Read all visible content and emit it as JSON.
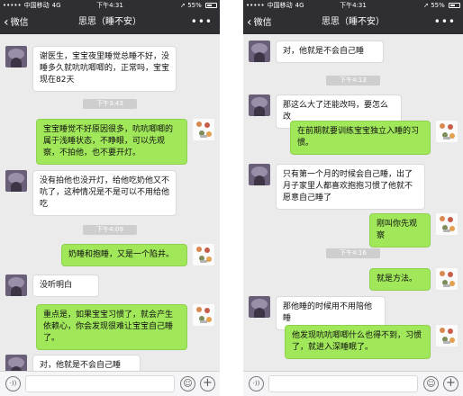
{
  "colors": {
    "navbar": "#2e2e33",
    "chat_bg": "#ebebeb",
    "bubble_out": "#a0e75a",
    "bubble_in": "#ffffff",
    "timestamp_bg": "#cecece",
    "input_bar": "#f5f5f7"
  },
  "status_bar": {
    "signal": "•••••",
    "carrier": "中国移动",
    "network": "4G",
    "time": "下午4:31",
    "location_icon": "location-arrow-icon",
    "battery_percent": "55%",
    "battery_level": 0.55
  },
  "nav": {
    "back_label": "微信",
    "title": "思思（睡不安）",
    "more_label": "•••"
  },
  "input_bar": {
    "voice_icon": "voice-icon",
    "voice_glyph": "·))",
    "emoji_icon": "emoji-icon",
    "emoji_glyph": "☺",
    "plus_icon": "plus-icon",
    "plus_glyph": "+"
  },
  "left_chat": [
    {
      "kind": "message",
      "sender": "doctor-client",
      "direction": "in",
      "text": "谢医生，宝宝夜里睡觉总睡不好，没睡多久就吭吭唧唧的，正常吗，宝宝现在82天"
    },
    {
      "kind": "timestamp",
      "text": "下午3:43"
    },
    {
      "kind": "message",
      "sender": "self",
      "direction": "out",
      "text": "宝宝睡觉不好原因很多，吭吭唧唧的属于浅睡状态，不睁眼，可以先观察，不拍他，也不要开灯。"
    },
    {
      "kind": "message",
      "sender": "doctor-client",
      "direction": "in",
      "text": "没有拍他也没开灯，给他吃奶他又不吭了，这种情况是不是可以不用给他吃"
    },
    {
      "kind": "timestamp",
      "text": "下午4:09"
    },
    {
      "kind": "message",
      "sender": "self",
      "direction": "out",
      "text": "奶睡和抱睡，又是一个陷井。"
    },
    {
      "kind": "message",
      "sender": "doctor-client",
      "direction": "in",
      "text": "没听明白"
    },
    {
      "kind": "message",
      "sender": "self",
      "direction": "out",
      "text": "重点是，如果宝宝习惯了，就会产生依赖心，你会发现很难让宝宝自己睡了。"
    },
    {
      "kind": "message",
      "sender": "doctor-client",
      "direction": "in",
      "text": "对，他就是不会自己睡"
    }
  ],
  "right_chat": [
    {
      "kind": "message",
      "sender": "doctor-client",
      "direction": "in",
      "text": "对，他就是不会自己睡"
    },
    {
      "kind": "timestamp",
      "text": "下午4:13"
    },
    {
      "kind": "message",
      "sender": "doctor-client",
      "direction": "in",
      "text": "那这么大了还能改吗，要怎么改"
    },
    {
      "kind": "message",
      "sender": "self",
      "direction": "out",
      "text": "在前期就要训练宝宝独立入睡的习惯。"
    },
    {
      "kind": "message",
      "sender": "doctor-client",
      "direction": "in",
      "text": "只有第一个月的时候会自己睡，出了月子家里人都喜欢抱抱习惯了他就不愿意自己睡了"
    },
    {
      "kind": "message",
      "sender": "self",
      "direction": "out",
      "text": "刚叫你先观察"
    },
    {
      "kind": "timestamp",
      "text": "下午4:16"
    },
    {
      "kind": "message",
      "sender": "self",
      "direction": "out",
      "text": "就是方法。"
    },
    {
      "kind": "message",
      "sender": "doctor-client",
      "direction": "in",
      "text": "那他睡的时候用不用陪他睡"
    },
    {
      "kind": "message",
      "sender": "self",
      "direction": "out",
      "text": "他发现吭吭唧唧什么也得不到，习惯了，就进入深睡眠了。"
    }
  ]
}
